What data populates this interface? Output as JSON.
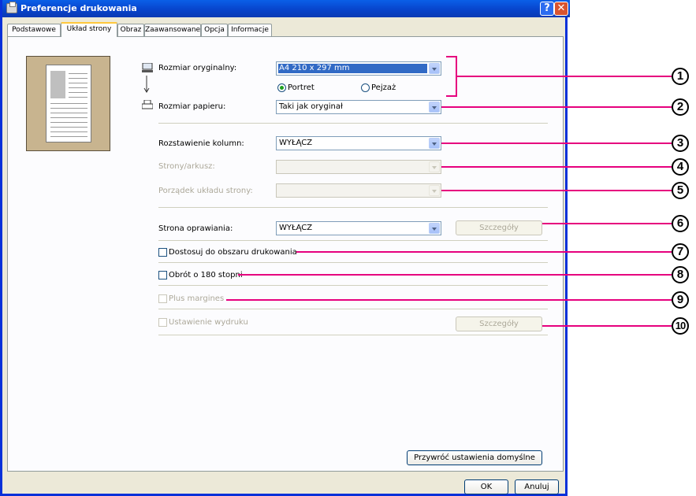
{
  "window": {
    "title": "Preferencje drukowania",
    "help": "?",
    "close": "✕"
  },
  "tabs": [
    {
      "label": "Podstawowe"
    },
    {
      "label": "Układ strony"
    },
    {
      "label": "Obraz"
    },
    {
      "label": "Zaawansowane"
    },
    {
      "label": "Opcja"
    },
    {
      "label": "Informacje"
    }
  ],
  "form": {
    "original_size_label": "Rozmiar oryginalny:",
    "original_size_value": "A4 210 x 297 mm",
    "portrait_label": "Portret",
    "landscape_label": "Pejzaż",
    "paper_size_label": "Rozmiar papieru:",
    "paper_size_value": "Taki jak oryginał",
    "column_label": "Rozstawienie kolumn:",
    "column_value": "WYŁĄCZ",
    "pages_label": "Strony/arkusz:",
    "order_label": "Porządek układu strony:",
    "binding_label": "Strona oprawiania:",
    "binding_value": "WYŁĄCZ",
    "binding_details": "Szczegóły",
    "fit_label": "Dostosuj do obszaru drukowania",
    "rotate_label": "Obrót o 180 stopni",
    "margins_label": "Plus margines",
    "output_label": "Ustawienie wydruku",
    "output_details": "Szczegóły",
    "restore_defaults": "Przywróć ustawienia domyślne"
  },
  "buttons": {
    "ok": "OK",
    "cancel": "Anuluj"
  },
  "callouts": [
    "1",
    "2",
    "3",
    "4",
    "5",
    "6",
    "7",
    "8",
    "9",
    "10"
  ],
  "colors": {
    "callout": "#e6007e",
    "titlebar": "#0842c9",
    "selection": "#316ac5"
  }
}
